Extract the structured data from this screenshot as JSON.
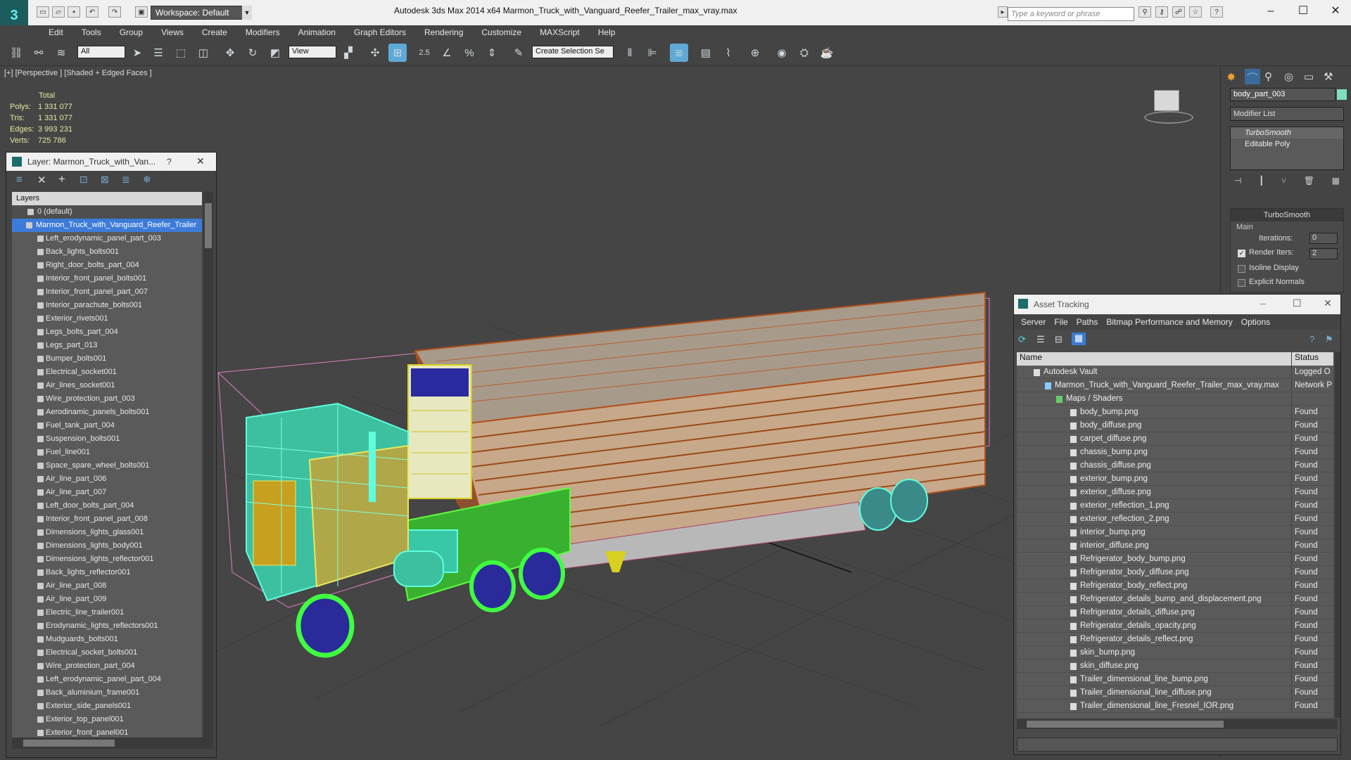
{
  "title_bar": {
    "workspace": "Workspace: Default",
    "app_title": "Autodesk 3ds Max  2014 x64      Marmon_Truck_with_Vanguard_Reefer_Trailer_max_vray.max",
    "search_placeholder": "Type a keyword or phrase"
  },
  "menu": [
    "Edit",
    "Tools",
    "Group",
    "Views",
    "Create",
    "Modifiers",
    "Animation",
    "Graph Editors",
    "Rendering",
    "Customize",
    "MAXScript",
    "Help"
  ],
  "toolbar": {
    "selection_filter": "All",
    "reference_coord": "View",
    "selection_set": "Create Selection Se",
    "snap_label": "2.5"
  },
  "viewport": {
    "label": "[+] [Perspective ] [Shaded + Edged Faces ]",
    "stats_header": "Total",
    "stats": [
      {
        "label": "Polys:",
        "value": "1 331 077"
      },
      {
        "label": "Tris:",
        "value": "1 331 077"
      },
      {
        "label": "Edges:",
        "value": "3 993 231"
      },
      {
        "label": "Verts:",
        "value": "725 786"
      }
    ]
  },
  "layer_panel": {
    "title": "Layer: Marmon_Truck_with_Van...",
    "help": "?",
    "header": "Layers",
    "default_layer": "0 (default)",
    "selected_layer": "Marmon_Truck_with_Vanguard_Reefer_Trailer",
    "items": [
      "Left_erodynamic_panel_part_003",
      "Back_lights_bolts001",
      "Right_door_bolts_part_004",
      "Interior_front_panel_bolts001",
      "Interior_front_panel_part_007",
      "Interior_parachute_bolts001",
      "Exterior_rivets001",
      "Legs_bolts_part_004",
      "Legs_part_013",
      "Bumper_bolts001",
      "Electrical_socket001",
      "Air_lines_socket001",
      "Wire_protection_part_003",
      "Aerodinamic_panels_bolts001",
      "Fuel_tank_part_004",
      "Suspension_bolts001",
      "Fuel_line001",
      "Space_spare_wheel_bolts001",
      "Air_line_part_006",
      "Air_line_part_007",
      "Left_door_bolts_part_004",
      "Interior_front_panel_part_008",
      "Dimensions_lights_glass001",
      "Dimensions_lights_body001",
      "Dimensions_lights_reflector001",
      "Back_lights_reflector001",
      "Air_line_part_008",
      "Air_line_part_009",
      "Electric_line_trailer001",
      "Erodynamic_lights_reflectors001",
      "Mudguards_bolts001",
      "Electrical_socket_bolts001",
      "Wire_protection_part_004",
      "Left_erodynamic_panel_part_004",
      "Back_aluminium_frame001",
      "Exterior_side_panels001",
      "Exterior_top_panel001",
      "Exterior_front_panel001"
    ]
  },
  "command_panel": {
    "object_name": "body_part_003",
    "modifier_list": "Modifier List",
    "stack": [
      "TurboSmooth",
      "Editable Poly"
    ],
    "rollout_title": "TurboSmooth",
    "group": "Main",
    "iterations_label": "Iterations:",
    "iterations_value": "0",
    "render_iters_label": "Render Iters:",
    "render_iters_value": "2",
    "isoline": "Isoline Display",
    "explicit": "Explicit Normals"
  },
  "asset_tracking": {
    "title": "Asset Tracking",
    "menu": [
      "Server",
      "File",
      "Paths",
      "Bitmap Performance and Memory",
      "Options"
    ],
    "col_name": "Name",
    "col_status": "Status",
    "vault": {
      "name": "Autodesk Vault",
      "status": "Logged O"
    },
    "file": {
      "name": "Marmon_Truck_with_Vanguard_Reefer_Trailer_max_vray.max",
      "status": "Network P"
    },
    "group": "Maps / Shaders",
    "maps": [
      {
        "name": "body_bump.png",
        "status": "Found"
      },
      {
        "name": "body_diffuse.png",
        "status": "Found"
      },
      {
        "name": "carpet_diffuse.png",
        "status": "Found"
      },
      {
        "name": "chassis_bump.png",
        "status": "Found"
      },
      {
        "name": "chassis_diffuse.png",
        "status": "Found"
      },
      {
        "name": "exterior_bump.png",
        "status": "Found"
      },
      {
        "name": "exterior_diffuse.png",
        "status": "Found"
      },
      {
        "name": "exterior_reflection_1.png",
        "status": "Found"
      },
      {
        "name": "exterior_reflection_2.png",
        "status": "Found"
      },
      {
        "name": "interior_bump.png",
        "status": "Found"
      },
      {
        "name": "interior_diffuse.png",
        "status": "Found"
      },
      {
        "name": "Refrigerator_body_bump.png",
        "status": "Found"
      },
      {
        "name": "Refrigerator_body_diffuse.png",
        "status": "Found"
      },
      {
        "name": "Refrigerator_body_reflect.png",
        "status": "Found"
      },
      {
        "name": "Refrigerator_details_bump_and_displacement.png",
        "status": "Found"
      },
      {
        "name": "Refrigerator_details_diffuse.png",
        "status": "Found"
      },
      {
        "name": "Refrigerator_details_opacity.png",
        "status": "Found"
      },
      {
        "name": "Refrigerator_details_reflect.png",
        "status": "Found"
      },
      {
        "name": "skin_bump.png",
        "status": "Found"
      },
      {
        "name": "skin_diffuse.png",
        "status": "Found"
      },
      {
        "name": "Trailer_dimensional_line_bump.png",
        "status": "Found"
      },
      {
        "name": "Trailer_dimensional_line_diffuse.png",
        "status": "Found"
      },
      {
        "name": "Trailer_dimensional_line_Fresnel_IOR.png",
        "status": "Found"
      }
    ]
  }
}
